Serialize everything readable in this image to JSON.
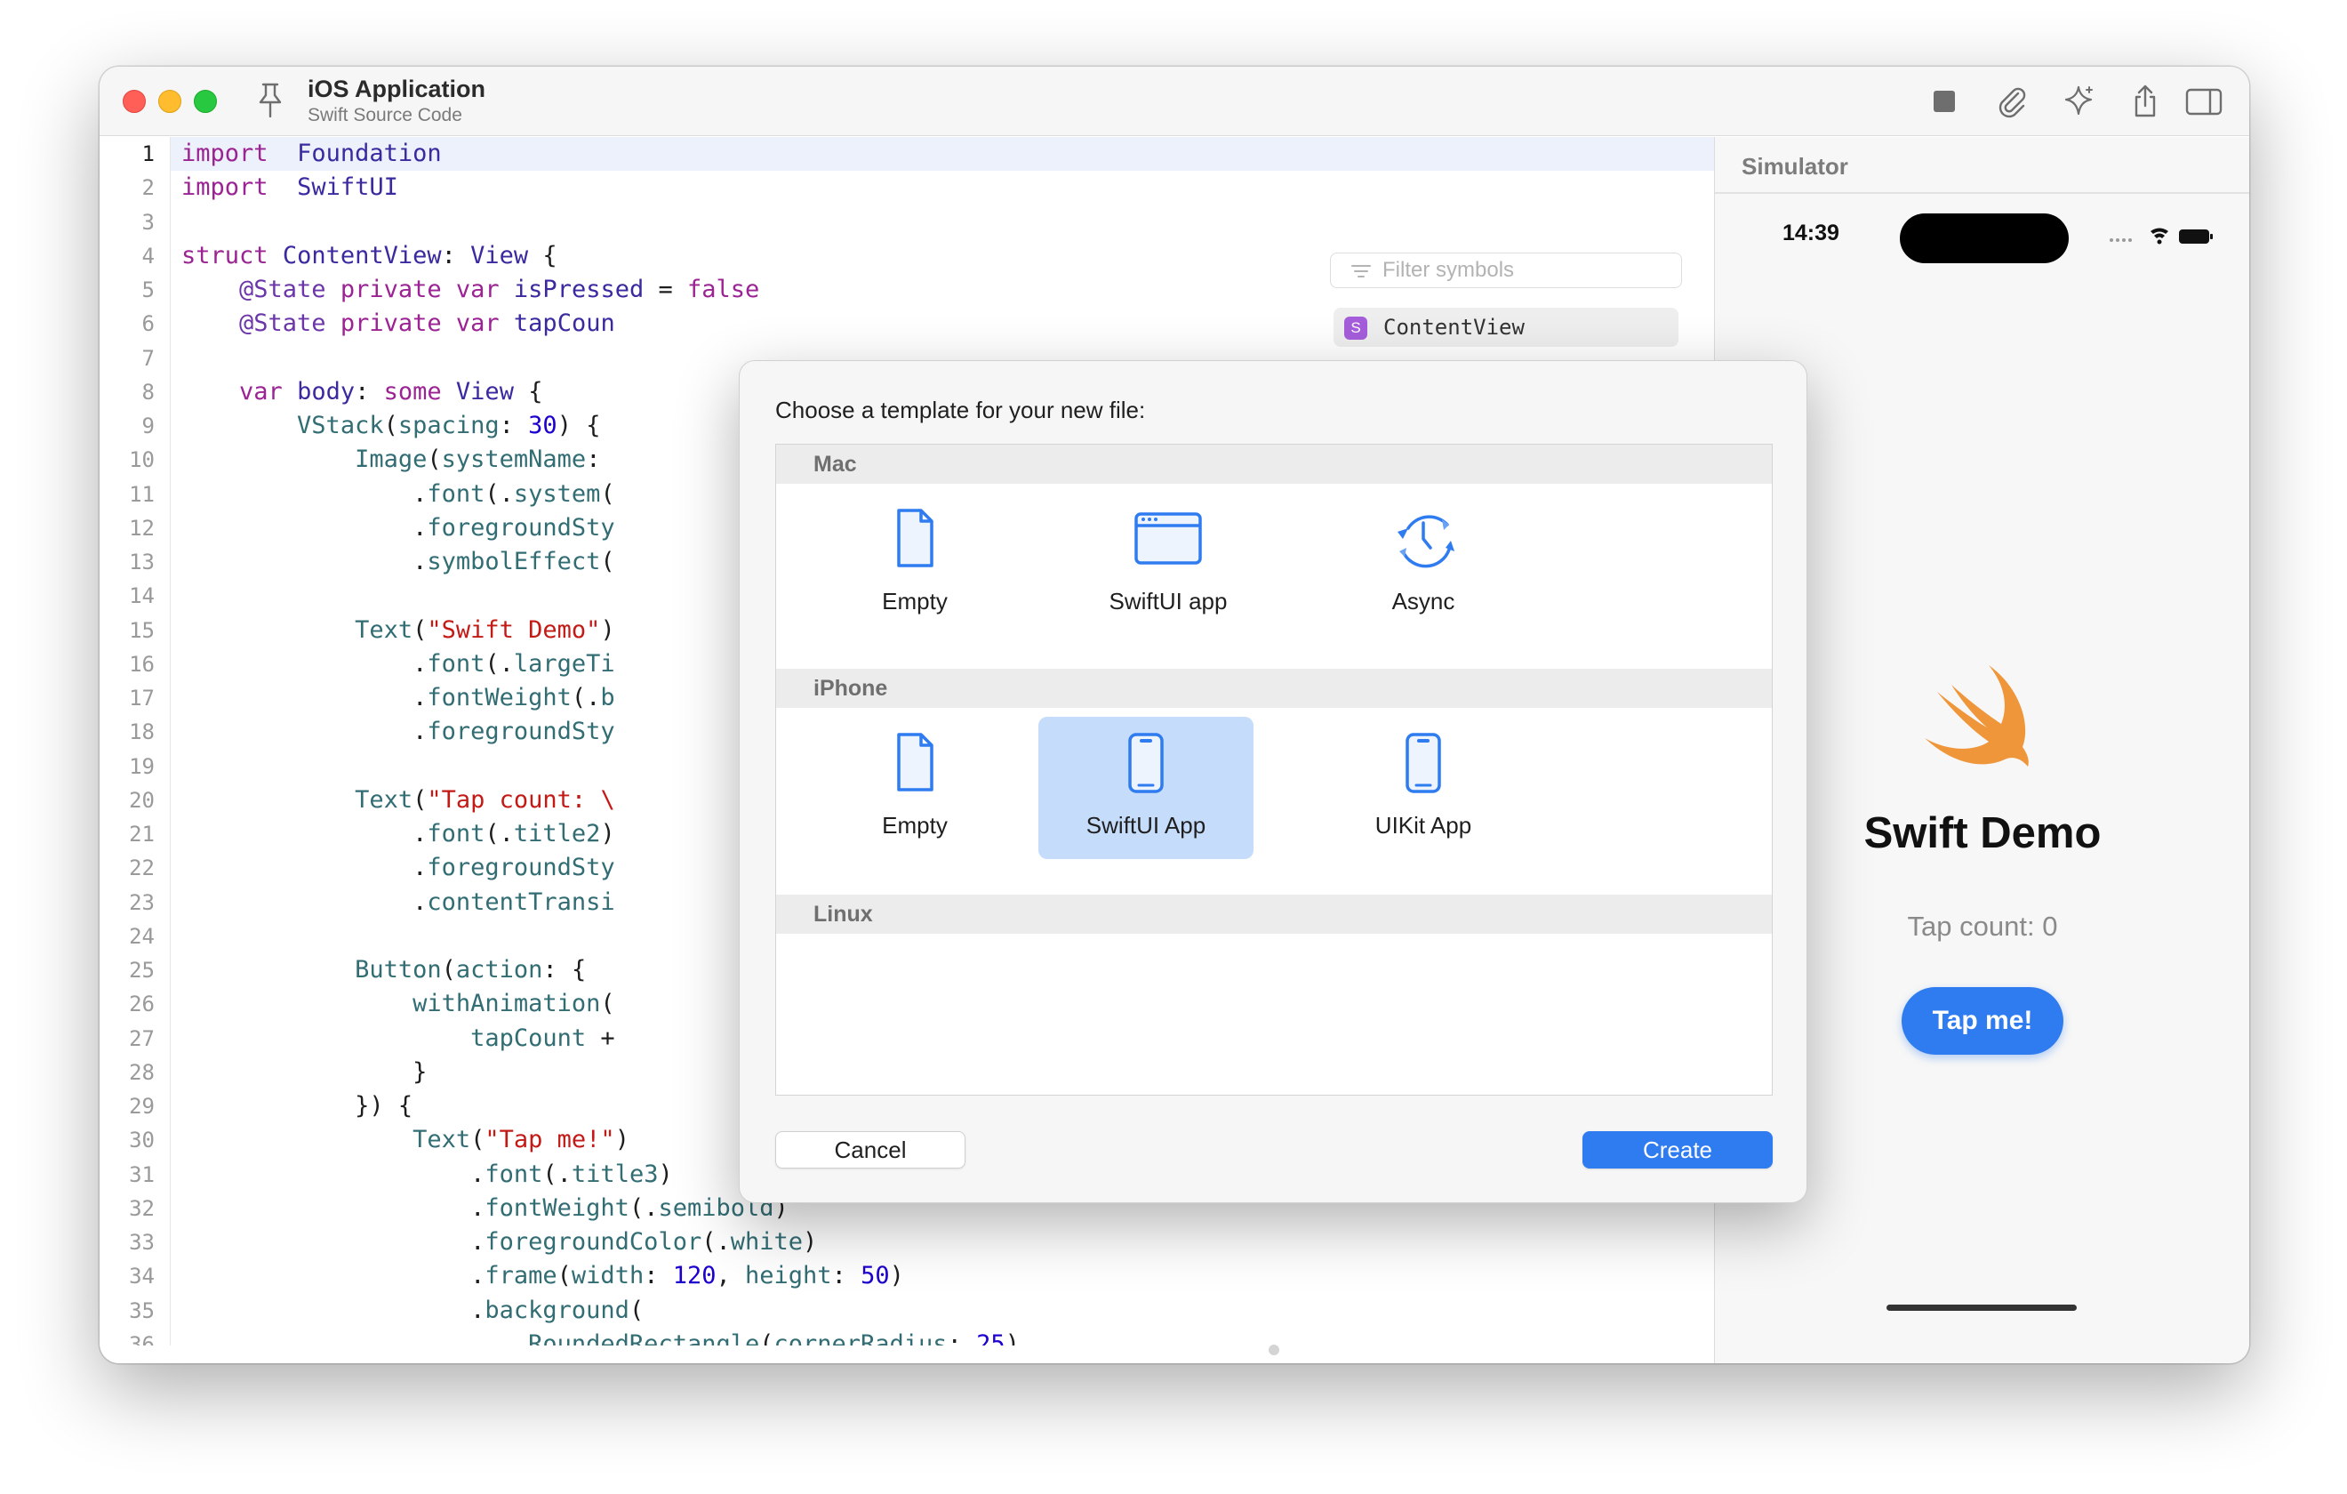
{
  "window": {
    "title": "iOS Application",
    "subtitle": "Swift Source Code"
  },
  "toolbar": {
    "icons": [
      "stop-icon",
      "paperclip-icon",
      "sparkle-icon",
      "share-icon",
      "sidebar-right-icon"
    ]
  },
  "editor": {
    "current_line": 1,
    "lines": [
      {
        "n": "1",
        "tokens": [
          [
            "kw",
            "import"
          ],
          [
            "",
            "  "
          ],
          [
            "ty",
            "Foundation"
          ]
        ]
      },
      {
        "n": "2",
        "tokens": [
          [
            "kw",
            "import"
          ],
          [
            "",
            "  "
          ],
          [
            "ty",
            "SwiftUI"
          ]
        ]
      },
      {
        "n": "3",
        "tokens": []
      },
      {
        "n": "4",
        "tokens": [
          [
            "kw",
            "struct"
          ],
          [
            "",
            " "
          ],
          [
            "ty",
            "ContentView"
          ],
          [
            "",
            ": "
          ],
          [
            "ty",
            "View"
          ],
          [
            "",
            " {"
          ]
        ]
      },
      {
        "n": "5",
        "tokens": [
          [
            "",
            "    "
          ],
          [
            "at",
            "@State"
          ],
          [
            "",
            " "
          ],
          [
            "kw",
            "private var"
          ],
          [
            "",
            " "
          ],
          [
            "ty",
            "isPressed"
          ],
          [
            "",
            " = "
          ],
          [
            "kw",
            "false"
          ]
        ]
      },
      {
        "n": "6",
        "tokens": [
          [
            "",
            "    "
          ],
          [
            "at",
            "@State"
          ],
          [
            "",
            " "
          ],
          [
            "kw",
            "private var"
          ],
          [
            "",
            " "
          ],
          [
            "ty",
            "tapCoun"
          ]
        ]
      },
      {
        "n": "7",
        "tokens": []
      },
      {
        "n": "8",
        "tokens": [
          [
            "",
            "    "
          ],
          [
            "kw",
            "var"
          ],
          [
            "",
            " "
          ],
          [
            "ty",
            "body"
          ],
          [
            "",
            ": "
          ],
          [
            "kw",
            "some"
          ],
          [
            "",
            " "
          ],
          [
            "ty",
            "View"
          ],
          [
            "",
            " {"
          ]
        ]
      },
      {
        "n": "9",
        "tokens": [
          [
            "",
            "        "
          ],
          [
            "fn",
            "VStack"
          ],
          [
            "",
            "("
          ],
          [
            "fn",
            "spacing"
          ],
          [
            "",
            ": "
          ],
          [
            "nu",
            "30"
          ],
          [
            "",
            ") {"
          ]
        ]
      },
      {
        "n": "10",
        "tokens": [
          [
            "",
            "            "
          ],
          [
            "fn",
            "Image"
          ],
          [
            "",
            "("
          ],
          [
            "fn",
            "systemName"
          ],
          [
            "",
            ":"
          ]
        ]
      },
      {
        "n": "11",
        "tokens": [
          [
            "",
            "                ."
          ],
          [
            "fn",
            "font"
          ],
          [
            "",
            "(."
          ],
          [
            "fn",
            "system"
          ],
          [
            "",
            "("
          ]
        ]
      },
      {
        "n": "12",
        "tokens": [
          [
            "",
            "                ."
          ],
          [
            "fn",
            "foregroundSty"
          ]
        ]
      },
      {
        "n": "13",
        "tokens": [
          [
            "",
            "                ."
          ],
          [
            "fn",
            "symbolEffect"
          ],
          [
            "",
            "("
          ]
        ]
      },
      {
        "n": "14",
        "tokens": []
      },
      {
        "n": "15",
        "tokens": [
          [
            "",
            "            "
          ],
          [
            "fn",
            "Text"
          ],
          [
            "",
            "("
          ],
          [
            "st",
            "\"Swift Demo\""
          ],
          [
            "",
            ")"
          ]
        ]
      },
      {
        "n": "16",
        "tokens": [
          [
            "",
            "                ."
          ],
          [
            "fn",
            "font"
          ],
          [
            "",
            "(."
          ],
          [
            "fn",
            "largeTi"
          ]
        ]
      },
      {
        "n": "17",
        "tokens": [
          [
            "",
            "                ."
          ],
          [
            "fn",
            "fontWeight"
          ],
          [
            "",
            "(."
          ],
          [
            "fn",
            "b"
          ]
        ]
      },
      {
        "n": "18",
        "tokens": [
          [
            "",
            "                ."
          ],
          [
            "fn",
            "foregroundSty"
          ]
        ]
      },
      {
        "n": "19",
        "tokens": []
      },
      {
        "n": "20",
        "tokens": [
          [
            "",
            "            "
          ],
          [
            "fn",
            "Text"
          ],
          [
            "",
            "("
          ],
          [
            "st",
            "\"Tap count: \\"
          ]
        ]
      },
      {
        "n": "21",
        "tokens": [
          [
            "",
            "                ."
          ],
          [
            "fn",
            "font"
          ],
          [
            "",
            "(."
          ],
          [
            "fn",
            "title2"
          ],
          [
            "",
            ")"
          ]
        ]
      },
      {
        "n": "22",
        "tokens": [
          [
            "",
            "                ."
          ],
          [
            "fn",
            "foregroundSty"
          ]
        ]
      },
      {
        "n": "23",
        "tokens": [
          [
            "",
            "                ."
          ],
          [
            "fn",
            "contentTransi"
          ]
        ]
      },
      {
        "n": "24",
        "tokens": []
      },
      {
        "n": "25",
        "tokens": [
          [
            "",
            "            "
          ],
          [
            "fn",
            "Button"
          ],
          [
            "",
            "("
          ],
          [
            "fn",
            "action"
          ],
          [
            "",
            ": {"
          ]
        ]
      },
      {
        "n": "26",
        "tokens": [
          [
            "",
            "                "
          ],
          [
            "fn",
            "withAnimation"
          ],
          [
            "",
            "("
          ]
        ]
      },
      {
        "n": "27",
        "tokens": [
          [
            "",
            "                    "
          ],
          [
            "fn",
            "tapCount"
          ],
          [
            "",
            " +"
          ]
        ]
      },
      {
        "n": "28",
        "tokens": [
          [
            "",
            "                }"
          ]
        ]
      },
      {
        "n": "29",
        "tokens": [
          [
            "",
            "            }) {"
          ]
        ]
      },
      {
        "n": "30",
        "tokens": [
          [
            "",
            "                "
          ],
          [
            "fn",
            "Text"
          ],
          [
            "",
            "("
          ],
          [
            "st",
            "\"Tap me!\""
          ],
          [
            "",
            ")"
          ]
        ]
      },
      {
        "n": "31",
        "tokens": [
          [
            "",
            "                    ."
          ],
          [
            "fn",
            "font"
          ],
          [
            "",
            "(."
          ],
          [
            "fn",
            "title3"
          ],
          [
            "",
            ")"
          ]
        ]
      },
      {
        "n": "32",
        "tokens": [
          [
            "",
            "                    ."
          ],
          [
            "fn",
            "fontWeight"
          ],
          [
            "",
            "(."
          ],
          [
            "fn",
            "semibold"
          ],
          [
            "",
            ")"
          ]
        ]
      },
      {
        "n": "33",
        "tokens": [
          [
            "",
            "                    ."
          ],
          [
            "fn",
            "foregroundColor"
          ],
          [
            "",
            "(."
          ],
          [
            "fn",
            "white"
          ],
          [
            "",
            ")"
          ]
        ]
      },
      {
        "n": "34",
        "tokens": [
          [
            "",
            "                    ."
          ],
          [
            "fn",
            "frame"
          ],
          [
            "",
            "("
          ],
          [
            "fn",
            "width"
          ],
          [
            "",
            ": "
          ],
          [
            "nu",
            "120"
          ],
          [
            "",
            ", "
          ],
          [
            "fn",
            "height"
          ],
          [
            "",
            ": "
          ],
          [
            "nu",
            "50"
          ],
          [
            "",
            ")"
          ]
        ]
      },
      {
        "n": "35",
        "tokens": [
          [
            "",
            "                    ."
          ],
          [
            "fn",
            "background"
          ],
          [
            "",
            "("
          ]
        ]
      },
      {
        "n": "36",
        "tokens": [
          [
            "",
            "                        "
          ],
          [
            "fn",
            "RoundedRectangle"
          ],
          [
            "",
            "("
          ],
          [
            "fn",
            "cornerRadius"
          ],
          [
            "",
            ": "
          ],
          [
            "nu",
            "25"
          ],
          [
            "",
            ")"
          ]
        ]
      }
    ]
  },
  "symbols": {
    "filter_placeholder": "Filter symbols",
    "items": [
      {
        "badge": "S",
        "label": "ContentView"
      }
    ]
  },
  "sheet": {
    "prompt": "Choose a template for your new file:",
    "sections": [
      {
        "title": "Mac",
        "templates": [
          {
            "label": "Empty",
            "icon": "document-icon",
            "selected": false
          },
          {
            "label": "SwiftUI app",
            "icon": "window-icon",
            "selected": false
          },
          {
            "label": "Async",
            "icon": "clock-arrows-icon",
            "selected": false
          }
        ]
      },
      {
        "title": "iPhone",
        "templates": [
          {
            "label": "Empty",
            "icon": "document-icon",
            "selected": false
          },
          {
            "label": "SwiftUI App",
            "icon": "iphone-icon",
            "selected": true
          },
          {
            "label": "UIKit App",
            "icon": "iphone-icon",
            "selected": false
          }
        ]
      },
      {
        "title": "Linux",
        "templates": []
      }
    ],
    "cancel_label": "Cancel",
    "create_label": "Create"
  },
  "simulator": {
    "panel_title": "Simulator",
    "status_time": "14:39",
    "heading": "Swift Demo",
    "tap_count": "Tap count: 0",
    "button_label": "Tap me!"
  },
  "colors": {
    "accent": "#2f7bf0",
    "selection": "#c5dcfb",
    "swift_orange": "#f0963a",
    "keyword": "#9b2393"
  }
}
